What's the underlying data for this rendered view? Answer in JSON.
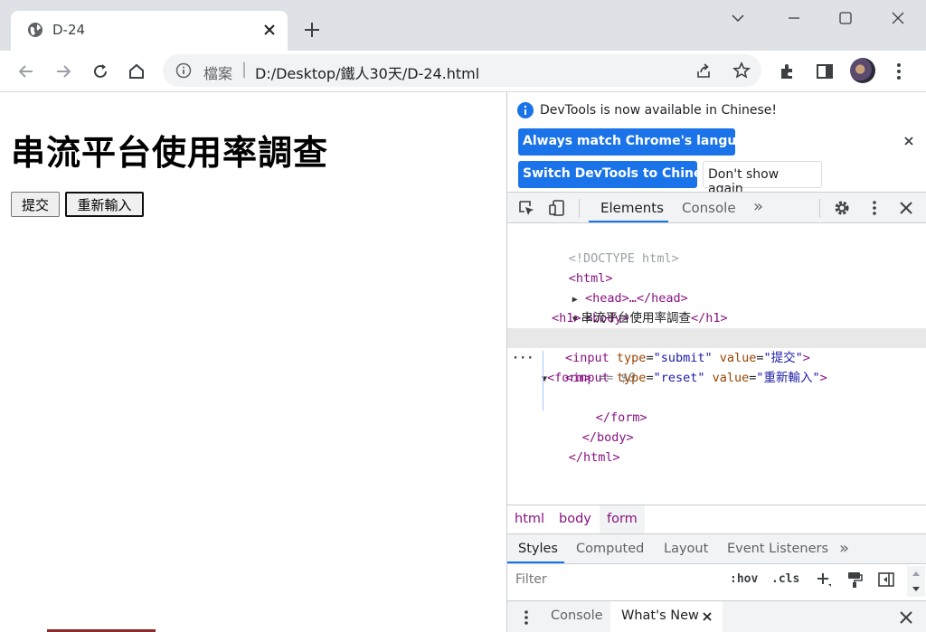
{
  "browser": {
    "tab_title": "D-24",
    "url_scheme": "檔案",
    "url_separator": "|",
    "url_text": "D:/Desktop/鐵人30天/D-24.html"
  },
  "page": {
    "heading": "串流平台使用率調查",
    "submit_label": "提交",
    "reset_label": "重新輸入"
  },
  "devtools": {
    "notice_text": "DevTools is now available in Chinese!",
    "match_language_label": "Always match Chrome's language",
    "switch_chinese_label": "Switch DevTools to Chinese",
    "dont_show_label": "Don't show again",
    "tabs": {
      "elements": "Elements",
      "console": "Console",
      "more": "»"
    },
    "dom": {
      "doctype": "<!DOCTYPE html>",
      "html_open": "<html>",
      "head": "<head>…</head>",
      "body_open": "<body>",
      "h1_open": "<h1>",
      "h1_text": "串流平台使用率調查",
      "h1_close": "</h1>",
      "form_open": "<form>",
      "form_marker": "== $0",
      "input_open": "<input",
      "type_attr": "type",
      "value_attr": "value",
      "submit_type": "\"submit\"",
      "submit_value": "\"提交\"",
      "reset_type": "\"reset\"",
      "reset_value": "\"重新輸入\"",
      "input_close": ">",
      "eq": "=",
      "form_close": "</form>",
      "body_close": "</body>",
      "html_close": "</html>",
      "ellipsis": "···"
    },
    "breadcrumbs": [
      "html",
      "body",
      "form"
    ],
    "styles_tabs": {
      "styles": "Styles",
      "computed": "Computed",
      "layout": "Layout",
      "listeners": "Event Listeners",
      "more": "»"
    },
    "filter_placeholder": "Filter",
    "hov_label": ":hov",
    "cls_label": ".cls",
    "drawer": {
      "console": "Console",
      "whats_new": "What's New"
    }
  }
}
